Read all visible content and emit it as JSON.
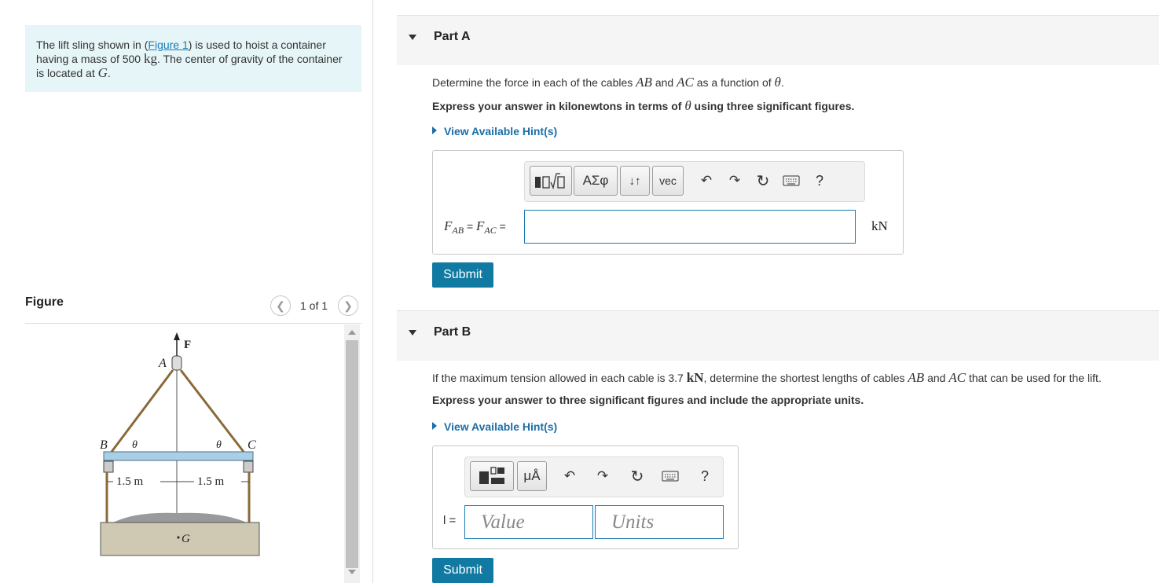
{
  "intro": {
    "text_before": "The lift sling shown in (",
    "figure_link": "Figure 1",
    "text_mid": ") is used to hoist a container having a mass of 500 ",
    "mass_unit": "kg",
    "text_after": ". The center of gravity of the container is located at ",
    "cg_symbol": "G",
    "period": "."
  },
  "figure_panel": {
    "title": "Figure",
    "pager": "1 of 1",
    "prev_icon": "chevron-left-icon",
    "next_icon": "chevron-right-icon",
    "labels": {
      "force": "F",
      "point_a": "A",
      "point_b": "B",
      "point_c": "C",
      "theta_left": "θ",
      "theta_right": "θ",
      "dim_left": "1.5 m",
      "dim_right": "1.5 m",
      "cg": "G"
    }
  },
  "part_a": {
    "title": "Part A",
    "question_before": "Determine the force in each of the cables ",
    "cable_ab": "AB",
    "question_and": " and ",
    "cable_ac": "AC",
    "question_after": " as a function of ",
    "theta": "θ",
    "question_end": ".",
    "instruction_before": "Express your answer in kilonewtons in terms of ",
    "instruction_theta": "θ",
    "instruction_after": " using three significant figures.",
    "hint": "View Available Hint(s)",
    "toolbar": {
      "templates_icon": "templates-icon",
      "greek": "ΑΣφ",
      "arrows": "↓↑",
      "vec": "vec",
      "undo_icon": "undo-icon",
      "redo_icon": "redo-icon",
      "reset_icon": "reset-icon",
      "keyboard_icon": "keyboard-icon",
      "help": "?"
    },
    "label_f1": "F",
    "label_f1_sub": "AB",
    "label_eq1": " = ",
    "label_f2": "F",
    "label_f2_sub": "AC",
    "label_eq2": " = ",
    "answer_value": "",
    "unit": "kN",
    "submit": "Submit"
  },
  "part_b": {
    "title": "Part B",
    "question_before": "If the maximum tension allowed in each cable is 3.7 ",
    "tension_unit": "kN",
    "question_mid": ", determine the shortest lengths of cables ",
    "cable_ab": "AB",
    "question_and": " and ",
    "cable_ac": "AC",
    "question_after": " that can be used for the lift.",
    "instruction": "Express your answer to three significant figures and include the appropriate units.",
    "hint": "View Available Hint(s)",
    "toolbar": {
      "templates_icon": "templates-icon",
      "units": "μÅ",
      "undo_icon": "undo-icon",
      "redo_icon": "redo-icon",
      "reset_icon": "reset-icon",
      "keyboard_icon": "keyboard-icon",
      "help": "?"
    },
    "label": "l =",
    "value_placeholder": "Value",
    "units_placeholder": "Units",
    "submit": "Submit"
  },
  "colors": {
    "intro_bg": "#e6f5f7",
    "link": "#1b7ab5",
    "submit_bg": "#117aa2",
    "part_header_bg": "#f5f5f5",
    "beam": "#a9cfe6",
    "container": "#cfc8b2"
  }
}
